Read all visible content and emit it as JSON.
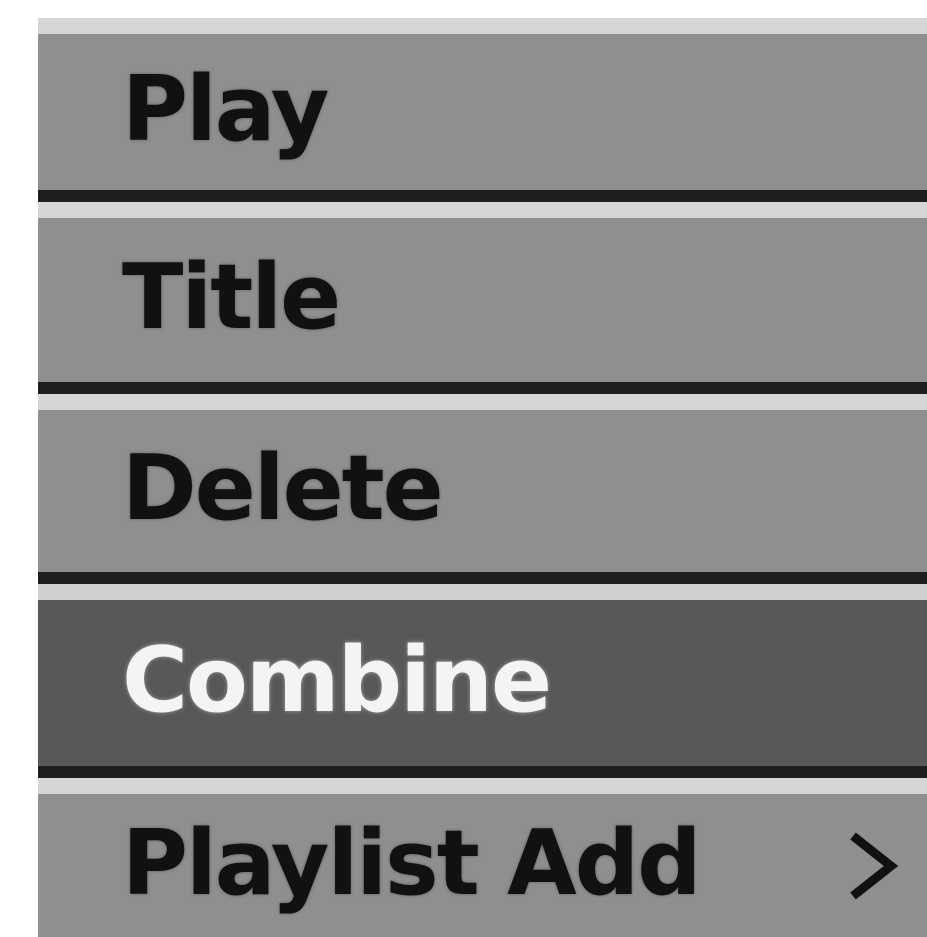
{
  "menu": {
    "items": [
      {
        "label": "Play"
      },
      {
        "label": "Title"
      },
      {
        "label": "Delete"
      },
      {
        "label": "Combine"
      },
      {
        "label": "Playlist Add"
      }
    ],
    "selected_index": 3,
    "submenu_icon": "chevron-right-icon"
  },
  "colors": {
    "item_bg": "#8f8f8f",
    "selected_bg": "#585858",
    "separator_light": "#d6d6d6",
    "separator_dark": "#1e1e1e",
    "text": "#111111",
    "selected_text": "#f4f4f4"
  }
}
